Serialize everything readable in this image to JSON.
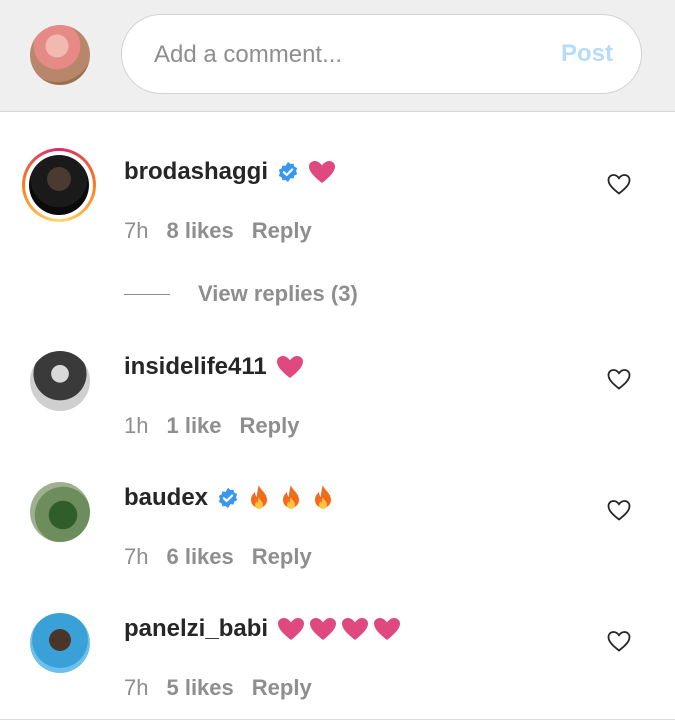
{
  "composer": {
    "placeholder": "Add a comment...",
    "post_label": "Post"
  },
  "colors": {
    "heart_emoji": "#e0497f",
    "verified_blue": "#3897f0",
    "post_disabled": "#b8dcf7"
  },
  "comments": [
    {
      "username": "brodashaggi",
      "verified": true,
      "emoji": [
        "heart"
      ],
      "time": "7h",
      "likes": "8 likes",
      "reply": "Reply",
      "story_ring": true,
      "view_replies": "View replies (3)"
    },
    {
      "username": "insidelife411",
      "verified": false,
      "emoji": [
        "heart"
      ],
      "time": "1h",
      "likes": "1 like",
      "reply": "Reply"
    },
    {
      "username": "baudex",
      "verified": true,
      "emoji": [
        "fire",
        "fire",
        "fire"
      ],
      "time": "7h",
      "likes": "6 likes",
      "reply": "Reply"
    },
    {
      "username": "panelzi_babi",
      "verified": false,
      "emoji": [
        "heart",
        "heart",
        "heart",
        "heart"
      ],
      "time": "7h",
      "likes": "5 likes",
      "reply": "Reply"
    }
  ]
}
